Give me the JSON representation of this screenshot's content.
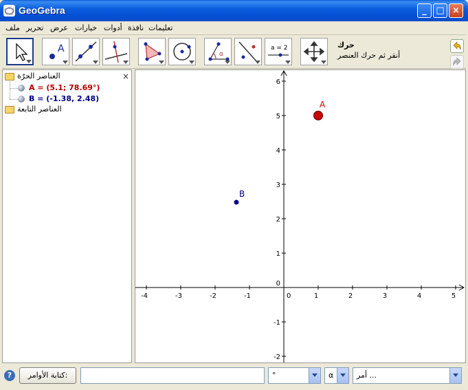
{
  "window": {
    "title": "GeoGebra",
    "minimize_label": "_",
    "maximize_label": "□",
    "close_label": "×"
  },
  "menu": {
    "items": [
      "ملف",
      "تحرير",
      "عرض",
      "خيارات",
      "أدوات",
      "نافذة",
      "تعليمات"
    ]
  },
  "toolbar": {
    "active_tool_name": "حرك",
    "active_tool_help": "أنقر ثم حرك العنصر",
    "tools": [
      "move",
      "new-point",
      "line-through-two-points",
      "perpendicular-line",
      "polygon",
      "circle-center-point",
      "angle",
      "reflect-about-line",
      "slider",
      "move-graphics-view"
    ],
    "slider_label": "a = 2",
    "angle_label": "α",
    "point_label": "A"
  },
  "algebra": {
    "free_objects_label": "العناصر الحرّة",
    "dependent_objects_label": "العناصر التابعة",
    "close_label": "×",
    "items": [
      {
        "text": "A = (5.1; 78.69°)",
        "color": "#b00000"
      },
      {
        "text": "B = (-1.38, 2.48)",
        "color": "#00008b"
      }
    ]
  },
  "graphics": {
    "x_ticks": [
      "-4",
      "-3",
      "-2",
      "-1",
      "0",
      "1",
      "2",
      "3",
      "4",
      "5"
    ],
    "y_ticks": [
      "6",
      "5",
      "4",
      "3",
      "2",
      "1",
      "0",
      "-1",
      "-2"
    ],
    "points": [
      {
        "label": "A",
        "x": 1.0,
        "y": 5.0,
        "color": "#cc0000"
      },
      {
        "label": "B",
        "x": -1.38,
        "y": 2.48,
        "color": "#00008b"
      }
    ]
  },
  "inputbar": {
    "help_icon_label": "?",
    "input_button_label": "كتابة الأوامر:",
    "input_value": "",
    "degree_symbol": "°",
    "greek_symbol": "α",
    "command_placeholder": "أمر ..."
  },
  "colors": {
    "title_blue": "#0a5bd8",
    "point_a": "#cc0000",
    "point_b": "#00008b"
  }
}
